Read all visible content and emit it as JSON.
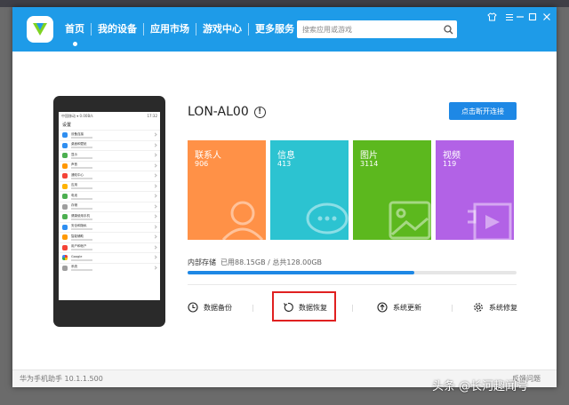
{
  "app": {
    "version_text": "华为手机助手 10.1.1.500"
  },
  "nav": {
    "items": [
      {
        "label": "首页",
        "active": true
      },
      {
        "label": "我的设备",
        "active": false
      },
      {
        "label": "应用市场",
        "active": false
      },
      {
        "label": "游戏中心",
        "active": false
      },
      {
        "label": "更多服务",
        "active": false
      }
    ]
  },
  "search": {
    "placeholder": "搜索应用或游戏"
  },
  "device": {
    "name": "LON-AL00",
    "disconnect_label": "点击断开连接"
  },
  "tiles": [
    {
      "label": "联系人",
      "count": "906",
      "color": "#ff9147"
    },
    {
      "label": "信息",
      "count": "413",
      "color": "#2cc3d1"
    },
    {
      "label": "图片",
      "count": "3114",
      "color": "#5cb81e"
    },
    {
      "label": "视频",
      "count": "119",
      "color": "#b262e6"
    }
  ],
  "storage": {
    "label": "内部存储",
    "used_text": "已用88.15GB / 总共128.00GB",
    "used_fraction": 0.6887
  },
  "actions": [
    {
      "label": "数据备份",
      "icon": "backup-icon"
    },
    {
      "label": "数据恢复",
      "icon": "restore-icon",
      "highlighted": true
    },
    {
      "label": "系统更新",
      "icon": "update-icon"
    },
    {
      "label": "系统修复",
      "icon": "repair-icon"
    }
  ],
  "footer": {
    "link_text": "反馈问题"
  },
  "watermark": {
    "text": "头条 @长河趣闻号"
  },
  "phone_screen": {
    "status_left": "中国移动 ▾ 0.00B/s",
    "status_right": "17:32",
    "title": "设置",
    "rows": [
      "设备连接",
      "桌面和壁纸",
      "显示",
      "声音",
      "通知中心",
      "应用",
      "电池",
      "存储",
      "健康使用手机",
      "安全和隐私",
      "智能辅助",
      "用户和帐户",
      "Google",
      "系统"
    ]
  },
  "colors": {
    "accent": "#1e9be8",
    "button": "#1e88e5",
    "highlight_box": "#e02020"
  }
}
